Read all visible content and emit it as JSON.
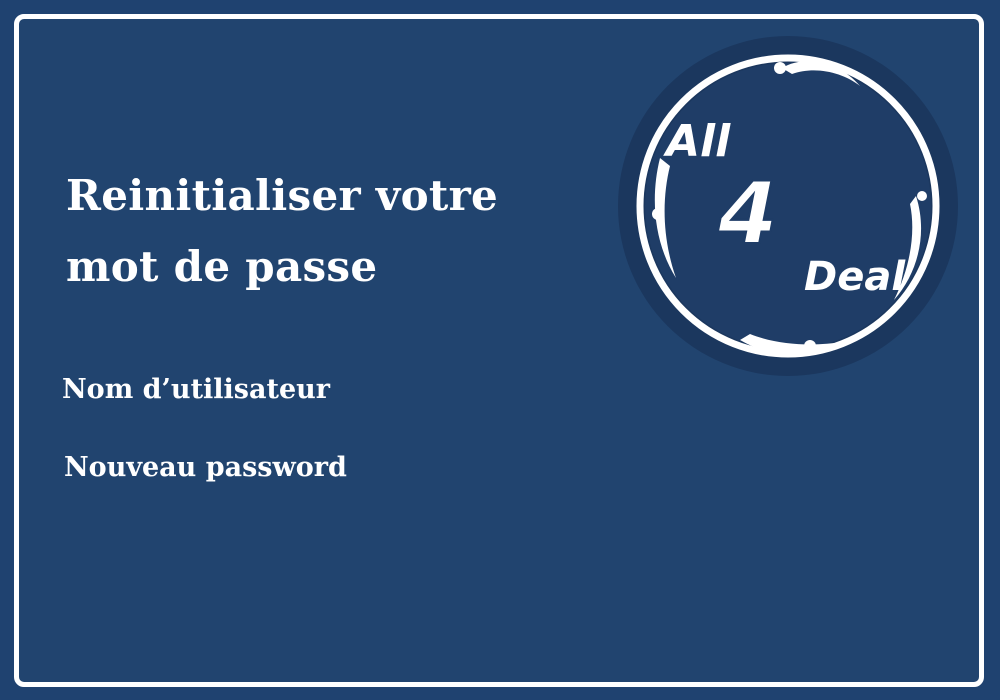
{
  "page": {
    "title_line1": "Reinitialiser votre",
    "title_line2": "mot de passe"
  },
  "form": {
    "username_label": "Nom d’utilisateur",
    "password_label": "Nouveau password"
  },
  "logo": {
    "text_top": "All",
    "text_number": "4",
    "text_bottom": "Deal"
  },
  "colors": {
    "background": "#1f4270",
    "panel": "#21446f",
    "logo_disc": "#1f3d67",
    "foreground": "#ffffff"
  }
}
